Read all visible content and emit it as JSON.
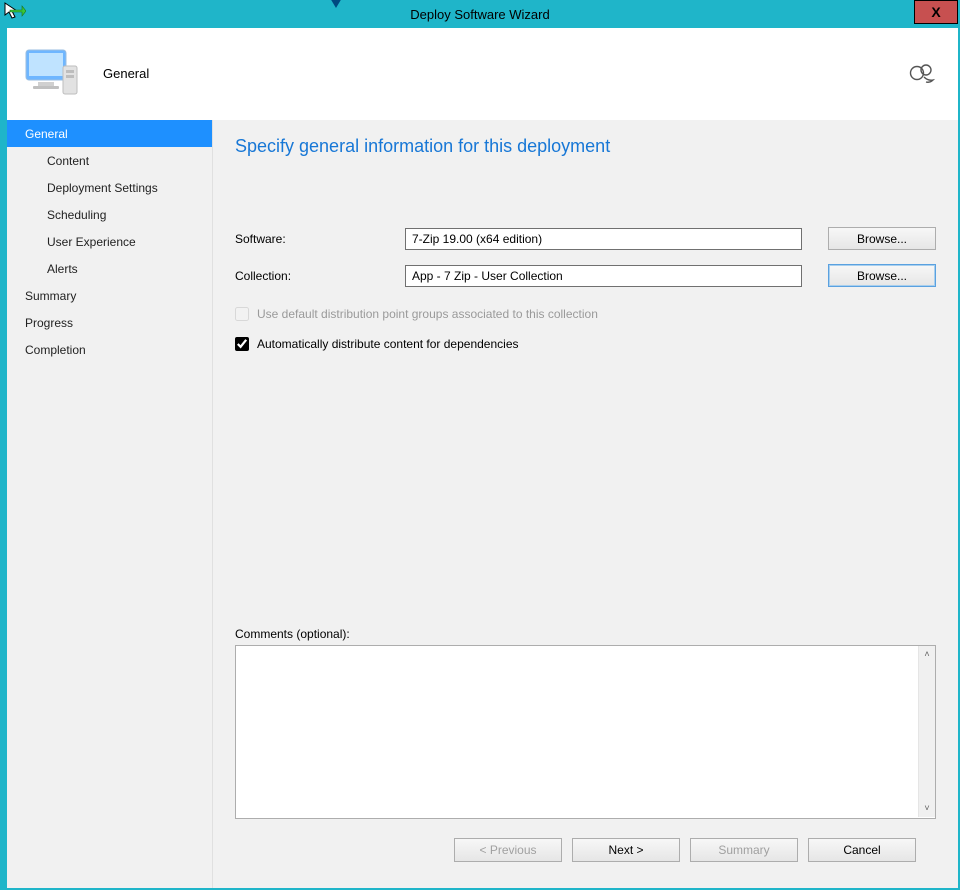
{
  "window": {
    "title": "Deploy Software Wizard",
    "close_label": "X"
  },
  "header": {
    "page_name": "General"
  },
  "sidebar": {
    "items": [
      {
        "label": "General",
        "indent": 1,
        "active": true
      },
      {
        "label": "Content",
        "indent": 2,
        "active": false
      },
      {
        "label": "Deployment Settings",
        "indent": 2,
        "active": false
      },
      {
        "label": "Scheduling",
        "indent": 2,
        "active": false
      },
      {
        "label": "User Experience",
        "indent": 2,
        "active": false
      },
      {
        "label": "Alerts",
        "indent": 2,
        "active": false
      },
      {
        "label": "Summary",
        "indent": 1,
        "active": false
      },
      {
        "label": "Progress",
        "indent": 1,
        "active": false
      },
      {
        "label": "Completion",
        "indent": 1,
        "active": false
      }
    ]
  },
  "main": {
    "title": "Specify general information for this deployment",
    "software_label": "Software:",
    "software_value": "7-Zip 19.00 (x64 edition)",
    "collection_label": "Collection:",
    "collection_value": "App - 7 Zip - User Collection",
    "browse_label": "Browse...",
    "chk_default_dp": "Use default distribution point groups associated to this collection",
    "chk_auto_dist": "Automatically distribute content for dependencies",
    "comments_label": "Comments (optional):",
    "comments_value": ""
  },
  "footer": {
    "previous": "< Previous",
    "next": "Next >",
    "summary": "Summary",
    "cancel": "Cancel"
  }
}
